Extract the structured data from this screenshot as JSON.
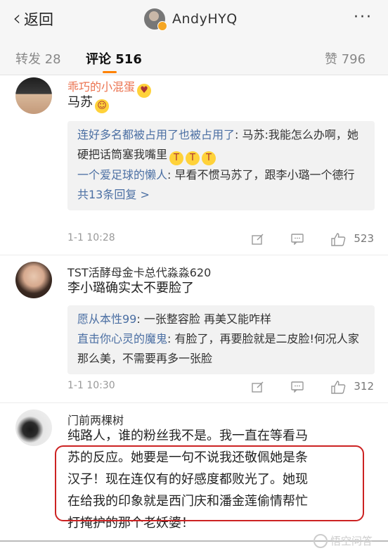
{
  "header": {
    "back_label": "返回",
    "username": "AndyHYQ",
    "more_label": "···"
  },
  "tabs": {
    "repost": "转发 28",
    "comments": "评论 516",
    "likes": "赞 796"
  },
  "comments": [
    {
      "user": "乖巧的小混蛋",
      "text": "马苏",
      "replies": [
        {
          "name": "连好多名都被占用了也被占用了",
          "text": ": 马苏:我能怎么办啊，她硬把话筒塞我嘴里"
        },
        {
          "name": "一个爱足球的懒人",
          "text": ": 早看不惯马苏了，跟李小璐一个德行"
        }
      ],
      "more_replies": "共13条回复 >",
      "time": "1-1 10:28",
      "likes": "523"
    },
    {
      "user": "TST活酵母金卡总代淼淼620",
      "text": "李小璐确实太不要脸了",
      "replies": [
        {
          "name": "愿从本性99",
          "text": ": 一张整容脸 再美又能咋样"
        },
        {
          "name": "直击你心灵的魔鬼",
          "text": ": 有脸了，再要脸就是二皮脸!何况人家那么美，不需要再多一张脸"
        }
      ],
      "time": "1-1 10:30",
      "likes": "312"
    },
    {
      "user": "门前两棵树",
      "lines": [
        "纯路人，谁的粉丝我不是。我一直在等看马",
        "苏的反应。她要是一句不说我还敬佩她是条",
        "汉子！现在连仅有的好感度都败光了。她现",
        "在给我的印象就是西门庆和潘金莲偷情帮忙",
        "打掩护的那个老妖婆！"
      ]
    }
  ],
  "watermark": "悟空问答",
  "colors": {
    "accent": "#ff8200",
    "link": "#4b6fa3",
    "highlight_box": "#cc2222"
  }
}
